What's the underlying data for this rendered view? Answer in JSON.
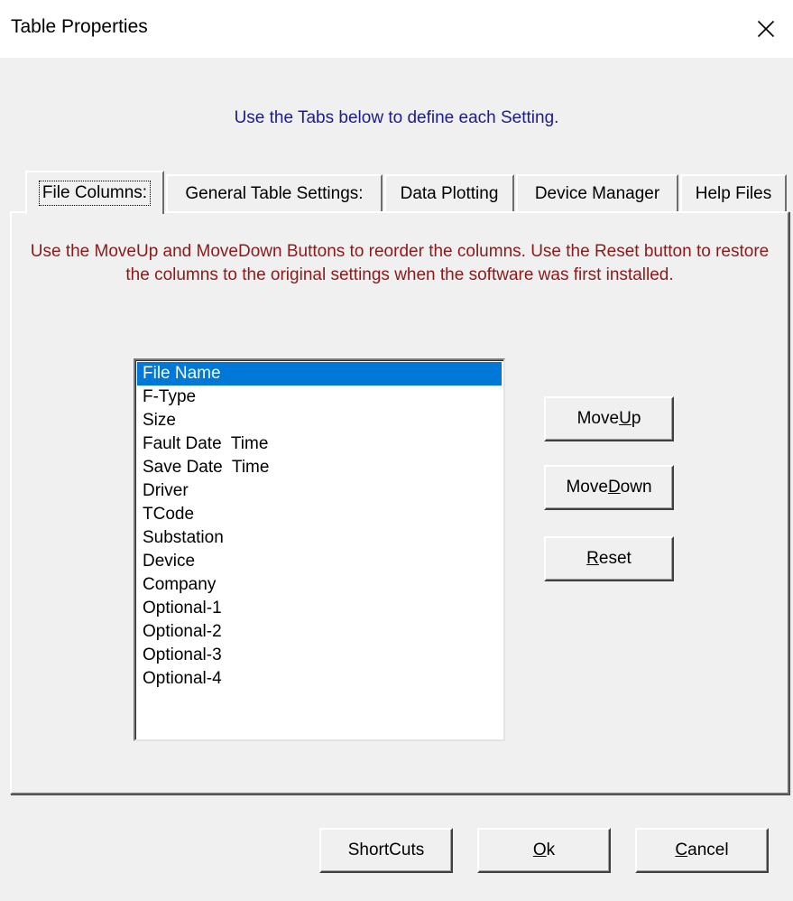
{
  "window": {
    "title": "Table Properties"
  },
  "instructions": "Use the Tabs below to define each Setting.",
  "tabs": [
    {
      "label": "File Columns:",
      "active": true
    },
    {
      "label": "General Table Settings:",
      "active": false
    },
    {
      "label": "Data Plotting",
      "active": false
    },
    {
      "label": "Device Manager",
      "active": false
    },
    {
      "label": "Help Files",
      "active": false
    }
  ],
  "file_columns": {
    "description": "Use the MoveUp and MoveDown Buttons to reorder the columns. Use the Reset button to restore the columns to the original settings when the software was first installed.",
    "columns": [
      {
        "label": "File Name",
        "selected": true
      },
      {
        "label": "F-Type",
        "selected": false
      },
      {
        "label": "Size",
        "selected": false
      },
      {
        "label": "Fault Date  Time",
        "selected": false
      },
      {
        "label": "Save Date  Time",
        "selected": false
      },
      {
        "label": "Driver",
        "selected": false
      },
      {
        "label": "TCode",
        "selected": false
      },
      {
        "label": "Substation",
        "selected": false
      },
      {
        "label": "Device",
        "selected": false
      },
      {
        "label": "Company",
        "selected": false
      },
      {
        "label": "Optional-1",
        "selected": false
      },
      {
        "label": "Optional-2",
        "selected": false
      },
      {
        "label": "Optional-3",
        "selected": false
      },
      {
        "label": "Optional-4",
        "selected": false
      }
    ],
    "buttons": {
      "move_up": {
        "pre": "Move ",
        "accel": "U",
        "post": "p"
      },
      "move_down": {
        "pre": "Move ",
        "accel": "D",
        "post": "own"
      },
      "reset": {
        "pre": "",
        "accel": "R",
        "post": "eset"
      }
    }
  },
  "footer": {
    "shortcuts": {
      "pre": "ShortCuts",
      "accel": "",
      "post": ""
    },
    "ok": {
      "pre": "",
      "accel": "O",
      "post": "k"
    },
    "cancel": {
      "pre": "",
      "accel": "C",
      "post": "ancel"
    }
  },
  "colors": {
    "instructions": "#1c1c8c",
    "description": "#8b1a1a",
    "selection": "#0078d7"
  }
}
